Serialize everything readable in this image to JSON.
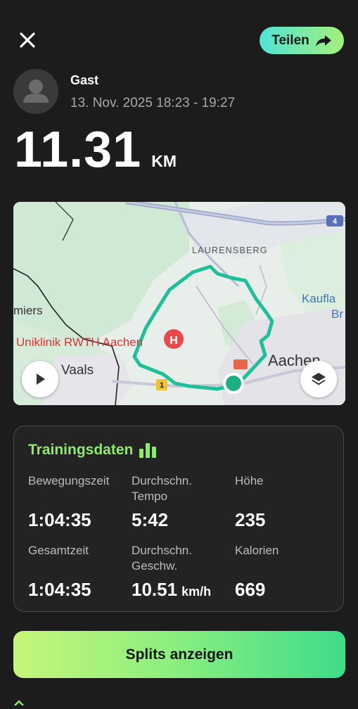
{
  "header": {
    "close_icon": "close-icon",
    "share_label": "Teilen",
    "share_icon": "share-arrow-icon"
  },
  "user": {
    "name": "Gast",
    "date_range": "13. Nov. 2025 18:23 - 19:27",
    "avatar_icon": "person-icon"
  },
  "distance": {
    "value": "11.31",
    "unit": "KM"
  },
  "map": {
    "labels": {
      "laurensberg": "LAURENSBERG",
      "uniklinik": "Uniklinik RWTH Aachen",
      "vaals": "Vaals",
      "aachen": "Aachen",
      "kaufland": "Kaufla",
      "br": "Br",
      "miers": "miers",
      "road_4": "4",
      "road_1": "1"
    },
    "route_color": "#1fbf9a",
    "play_icon": "play-icon",
    "layers_icon": "layers-icon"
  },
  "training": {
    "title": "Trainingsdaten",
    "title_icon": "bar-chart-icon",
    "moving_time_label": "Bewegungszeit",
    "moving_time": "1:04:35",
    "avg_pace_label_1": "Durchschn.",
    "avg_pace_label_2": "Tempo",
    "avg_pace": "5:42",
    "elevation_label": "Höhe",
    "elevation": "235",
    "total_time_label": "Gesamtzeit",
    "total_time": "1:04:35",
    "avg_speed_label_1": "Durchschn.",
    "avg_speed_label_2": "Geschw.",
    "avg_speed": "10.51",
    "avg_speed_unit": "km/h",
    "calories_label": "Kalorien",
    "calories": "669"
  },
  "splits_button_label": "Splits anzeigen",
  "colors": {
    "background": "#1c1c1c",
    "accent_green": "#8fea6a",
    "share_gradient_start": "#4fe3d8",
    "share_gradient_end": "#a4f07a"
  }
}
